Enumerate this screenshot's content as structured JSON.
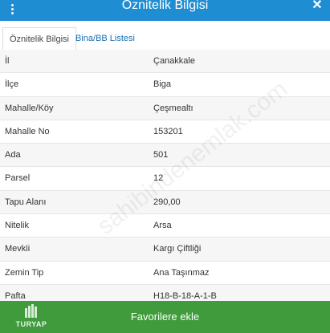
{
  "header": {
    "title": "Öznitelik Bilgisi",
    "close_label": "✕"
  },
  "tabs": [
    {
      "label": "Öznitelik Bilgisi",
      "active": true
    },
    {
      "label": "Bina/BB Listesi",
      "active": false
    }
  ],
  "rows": [
    {
      "key": "İl",
      "value": "Çanakkale"
    },
    {
      "key": "İlçe",
      "value": "Biga"
    },
    {
      "key": "Mahalle/Köy",
      "value": "Çeşmealtı"
    },
    {
      "key": "Mahalle No",
      "value": "153201"
    },
    {
      "key": "Ada",
      "value": "501"
    },
    {
      "key": "Parsel",
      "value": "12"
    },
    {
      "key": "Tapu Alanı",
      "value": "290,00"
    },
    {
      "key": "Nitelik",
      "value": "Arsa"
    },
    {
      "key": "Mevkii",
      "value": "Kargı Çiftliği"
    },
    {
      "key": "Zemin Tip",
      "value": "Ana Taşınmaz"
    },
    {
      "key": "Pafta",
      "value": "H18-B-18-A-1-B"
    }
  ],
  "watermark": "sahibindenemlak.com",
  "footer": {
    "button_label": "Favorilere ekle",
    "logo_text": "TURYAP"
  },
  "colors": {
    "header": "#1f8dd2",
    "footer": "#3f9b3c",
    "tab_link": "#1a6fad"
  }
}
